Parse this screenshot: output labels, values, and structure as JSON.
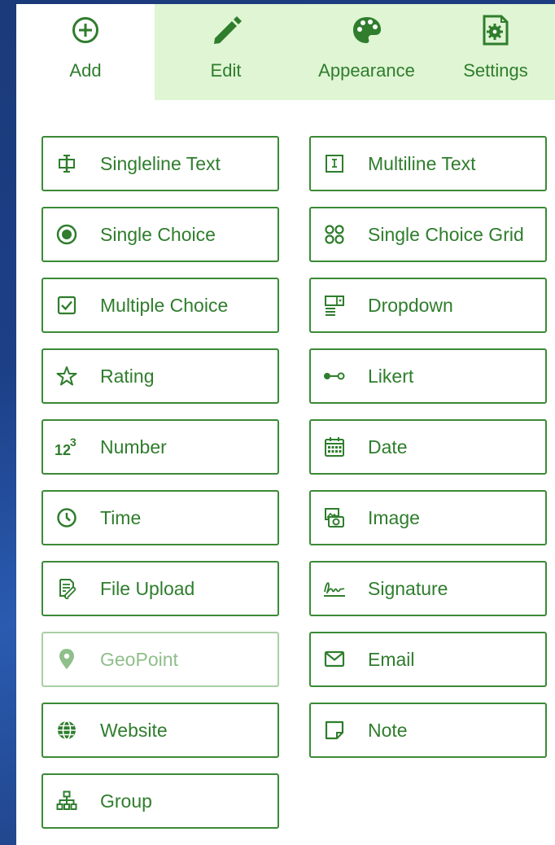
{
  "tabs": [
    {
      "label": "Add",
      "icon": "add-circle-icon",
      "active": true
    },
    {
      "label": "Edit",
      "icon": "pencil-icon",
      "active": false
    },
    {
      "label": "Appearance",
      "icon": "palette-icon",
      "active": false
    },
    {
      "label": "Settings",
      "icon": "settings-gear-icon",
      "active": false
    }
  ],
  "questions": {
    "singleline_text": "Singleline Text",
    "multiline_text": "Multiline Text",
    "single_choice": "Single Choice",
    "single_choice_grid": "Single Choice Grid",
    "multiple_choice": "Multiple Choice",
    "dropdown": "Dropdown",
    "rating": "Rating",
    "likert": "Likert",
    "number": "Number",
    "date": "Date",
    "time": "Time",
    "image": "Image",
    "file_upload": "File Upload",
    "signature": "Signature",
    "geopoint": "GeoPoint",
    "email": "Email",
    "website": "Website",
    "note": "Note",
    "group": "Group"
  },
  "colors": {
    "accent": "#2f7d2d",
    "border": "#3a8a36",
    "tab_inactive_bg": "#dff5d3",
    "disabled_text": "#8fbf8b"
  }
}
